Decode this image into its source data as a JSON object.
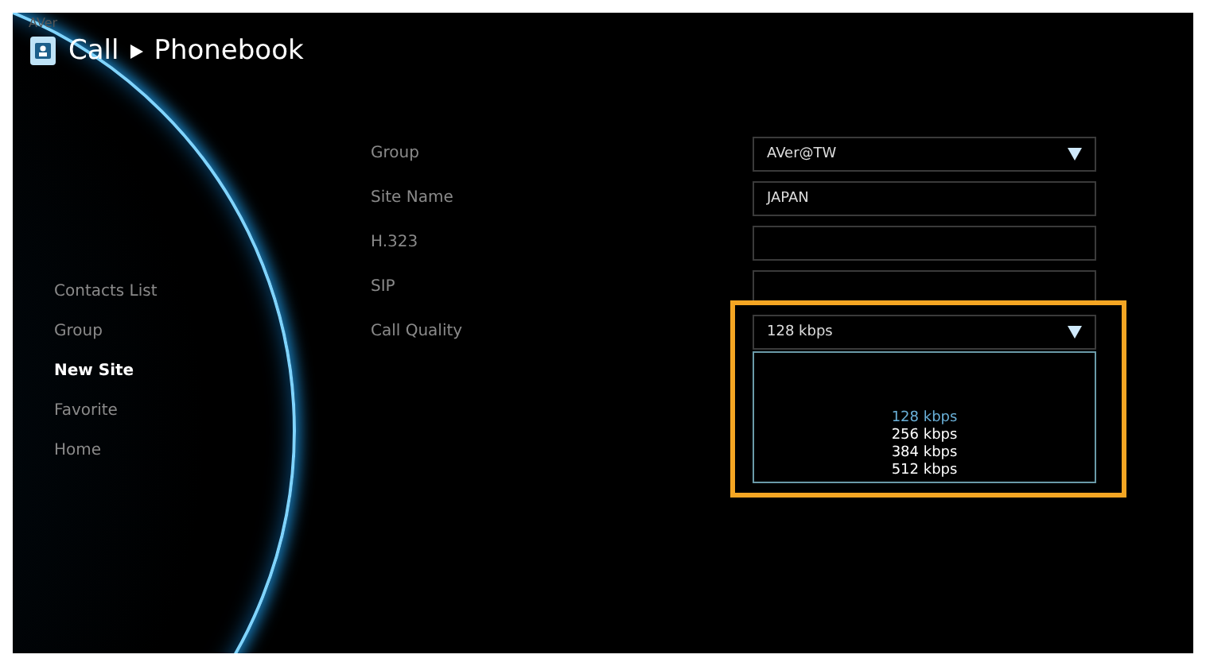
{
  "header": {
    "brand": "AVer",
    "breadcrumb": [
      "Call",
      "Phonebook"
    ]
  },
  "sidebar": {
    "items": [
      {
        "label": "Contacts List",
        "selected": false
      },
      {
        "label": "Group",
        "selected": false
      },
      {
        "label": "New Site",
        "selected": true
      },
      {
        "label": "Favorite",
        "selected": false
      },
      {
        "label": "Home",
        "selected": false
      }
    ]
  },
  "form": {
    "fields": [
      {
        "label": "Group",
        "kind": "dropdown",
        "value": "AVer@TW",
        "focused": false
      },
      {
        "label": "Site Name",
        "kind": "text",
        "value": "JAPAN",
        "focused": false
      },
      {
        "label": "H.323",
        "kind": "text",
        "focused": false
      },
      {
        "label": "SIP",
        "kind": "text",
        "focused": false
      },
      {
        "label": "Call Quality",
        "kind": "dropdown",
        "value": "128 kbps",
        "focused": true,
        "options": [
          {
            "label": "128 kbps",
            "selected": true
          },
          {
            "label": "256 kbps",
            "selected": false
          },
          {
            "label": "384 kbps",
            "selected": false
          },
          {
            "label": "512 kbps",
            "selected": false
          }
        ]
      }
    ]
  }
}
